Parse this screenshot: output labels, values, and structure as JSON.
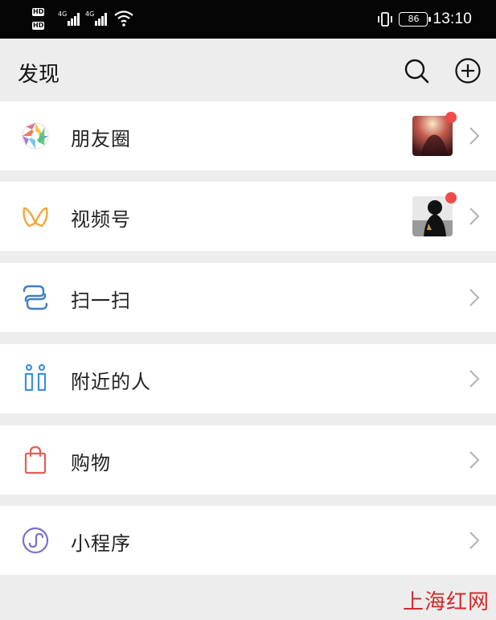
{
  "status_bar": {
    "network_badges": [
      "HD",
      "HD"
    ],
    "network_types": [
      "4G",
      "4G"
    ],
    "battery": "86",
    "time": "13:10"
  },
  "header": {
    "title": "发现",
    "search_icon": "search-icon",
    "add_icon": "plus-circle-icon"
  },
  "menu": [
    {
      "label": "朋友圈",
      "icon": "moments-aperture-icon",
      "has_thumbnail": true,
      "has_badge": true
    },
    {
      "label": "视频号",
      "icon": "channels-butterfly-icon",
      "has_thumbnail": true,
      "has_badge": true
    },
    {
      "label": "扫一扫",
      "icon": "scan-icon",
      "has_thumbnail": false,
      "has_badge": false
    },
    {
      "label": "附近的人",
      "icon": "people-nearby-icon",
      "has_thumbnail": false,
      "has_badge": false
    },
    {
      "label": "购物",
      "icon": "shopping-bag-icon",
      "has_thumbnail": false,
      "has_badge": false
    },
    {
      "label": "小程序",
      "icon": "mini-program-icon",
      "has_thumbnail": false,
      "has_badge": false
    }
  ],
  "watermark": "上海红网",
  "colors": {
    "background": "#ededed",
    "card": "#ffffff",
    "badge": "#f04a4a",
    "watermark": "#d12a2a"
  }
}
